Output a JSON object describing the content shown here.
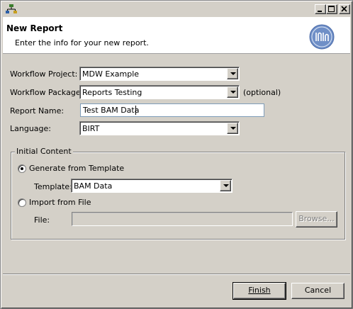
{
  "window": {
    "buttons": {
      "minimize": "_",
      "maximize": "□",
      "close": "✕"
    }
  },
  "banner": {
    "title": "New Report",
    "description": "Enter the info for your new report.",
    "logo_icon": "mdw-logo-icon"
  },
  "form": {
    "workflow_project": {
      "label": "Workflow Project:",
      "value": "MDW Example"
    },
    "workflow_package": {
      "label": "Workflow Package:",
      "value": "Reports Testing",
      "hint": "(optional)"
    },
    "report_name": {
      "label": "Report Name:",
      "value": "Test BAM Data"
    },
    "language": {
      "label": "Language:",
      "value": "BIRT"
    }
  },
  "initial_content": {
    "legend": "Initial Content",
    "generate_from_template": {
      "label": "Generate from Template",
      "checked": true
    },
    "template": {
      "label": "Template:",
      "value": "BAM Data"
    },
    "import_from_file": {
      "label": "Import from File",
      "checked": false
    },
    "file": {
      "label": "File:",
      "value": ""
    },
    "browse_label": "Browse..."
  },
  "footer": {
    "finish_label": "Finish",
    "cancel_label": "Cancel"
  },
  "colors": {
    "dialog_bg": "#d4d0c8",
    "banner_bg": "#ffffff",
    "logo_blue": "#6f8fc7"
  }
}
